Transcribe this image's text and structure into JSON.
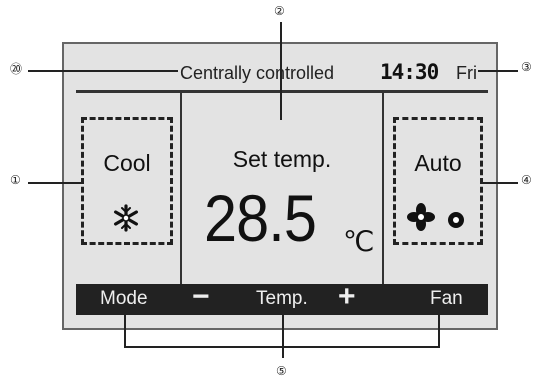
{
  "status": {
    "message": "Centrally controlled",
    "clock": "14:30",
    "day": "Fri"
  },
  "mode": {
    "label": "Cool",
    "icon": "snowflake-icon"
  },
  "setpoint": {
    "label": "Set temp.",
    "value": "28.5",
    "unit": "℃"
  },
  "fan": {
    "label": "Auto",
    "icons": [
      "fan-icon",
      "fan-small-icon"
    ]
  },
  "buttons": {
    "mode": "Mode",
    "minus": "−",
    "temp": "Temp.",
    "plus": "+",
    "fan": "Fan"
  },
  "callouts": {
    "c1": "①",
    "c2": "②",
    "c3": "③",
    "c4": "④",
    "c5": "⑤",
    "c20": "⑳"
  },
  "colors": {
    "screen_bg": "#e3e3e3",
    "bar_bg": "#222222",
    "ink": "#111111"
  }
}
